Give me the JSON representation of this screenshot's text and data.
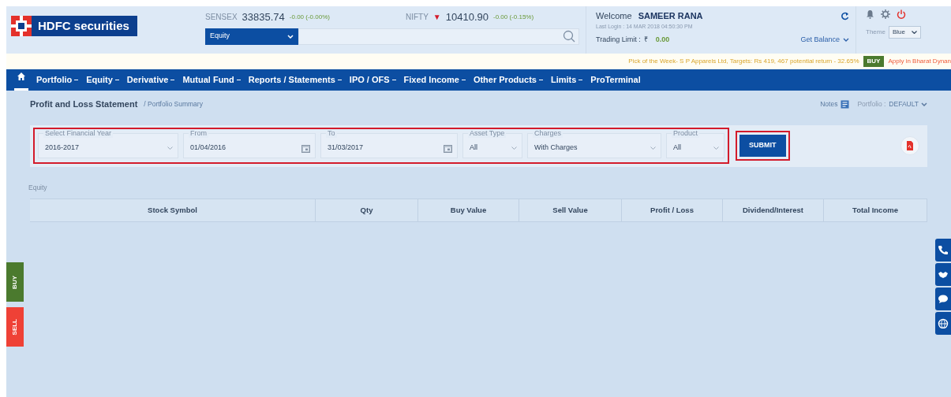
{
  "logo": {
    "text": "HDFC securities"
  },
  "indices": [
    {
      "name": "SENSEX",
      "value": "33835.74",
      "change": "-0.00 (-0.00%)"
    },
    {
      "name": "NIFTY",
      "value": "10410.90",
      "change": "-0.00 (-0.15%)",
      "arrow": "▼"
    }
  ],
  "search": {
    "segment": "Equity"
  },
  "user": {
    "welcome": "Welcome",
    "name": "SAMEER RANA",
    "last_login": "Last Login : 14 MAR 2018 04:50:30 PM",
    "trading_limit_label": "Trading Limit :",
    "currency": "₹",
    "trading_limit": "0.00",
    "get_balance": "Get Balance"
  },
  "theme": {
    "label": "Theme",
    "value": "Blue"
  },
  "ticker": {
    "pick": "Pick of the Week- S P Apparels Ltd, Targets: Rs 419, 467 potential return - 32.65%",
    "badge": "BUY",
    "apply": "Apply in Bharat Dynan"
  },
  "home": {
    "selected": true
  },
  "nav": [
    {
      "label": "Portfolio",
      "dropdown": true
    },
    {
      "label": "Equity",
      "dropdown": true
    },
    {
      "label": "Derivative",
      "dropdown": true
    },
    {
      "label": "Mutual Fund",
      "dropdown": true
    },
    {
      "label": "Reports / Statements",
      "dropdown": true
    },
    {
      "label": "IPO / OFS",
      "dropdown": true
    },
    {
      "label": "Fixed Income",
      "dropdown": true
    },
    {
      "label": "Other Products",
      "dropdown": true
    },
    {
      "label": "Limits",
      "dropdown": true
    },
    {
      "label": "ProTerminal",
      "dropdown": false
    }
  ],
  "breadcrumb": {
    "title": "Profit and Loss Statement",
    "sub": "/ Portfolio Summary"
  },
  "notes": "Notes",
  "portfolio": {
    "label": "Portfolio :",
    "value": "DEFAULT"
  },
  "filters": [
    {
      "kind": "select",
      "label": "Select Financial Year",
      "value": "2016-2017"
    },
    {
      "kind": "date",
      "label": "From",
      "value": "01/04/2016"
    },
    {
      "kind": "date",
      "label": "To",
      "value": "31/03/2017"
    },
    {
      "kind": "select",
      "label": "Asset Type",
      "value": "All"
    },
    {
      "kind": "select",
      "label": "Charges",
      "value": "With Charges"
    },
    {
      "kind": "select",
      "label": "Product",
      "value": "All"
    }
  ],
  "submit": "SUBMIT",
  "section": "Equity",
  "table": {
    "columns": [
      "Stock Symbol",
      "Qty",
      "Buy Value",
      "Sell Value",
      "Profit / Loss",
      "Dividend/Interest",
      "Total Income"
    ]
  },
  "side_tabs": [
    {
      "label": "BUY",
      "color": "#4b7a2e"
    },
    {
      "label": "SELL",
      "color": "#ef4136"
    }
  ]
}
